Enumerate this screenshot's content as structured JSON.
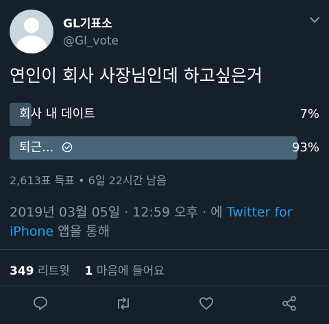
{
  "profile": {
    "display_name": "GL기표소",
    "handle": "@Gl_vote"
  },
  "tweet": {
    "text": "연인이 회사 사장님인데 하고싶은거"
  },
  "poll": {
    "options": [
      {
        "label": "회사 내 데이트",
        "percent_text": "7%",
        "fraction": 0.07,
        "winner": false
      },
      {
        "label": "퇴근...",
        "percent_text": "93%",
        "fraction": 0.93,
        "winner": true
      }
    ],
    "meta": "2,613표 득표 • 6일 22시간 남음"
  },
  "timestamp": {
    "prefix": "2019년 03월 05일 · 12:59 오후 · 에 ",
    "source_link": "Twitter for iPhone",
    "suffix": " 앱을 통해"
  },
  "stats": {
    "retweets_count": "349",
    "retweets_label": "리트윗",
    "likes_count": "1",
    "likes_label": "마음에 들어요"
  },
  "colors": {
    "background": "#15202b",
    "secondary_text": "#8899a6",
    "link": "#1da1f2",
    "poll_bar": "#3d5466"
  },
  "icons": [
    "chevron-down-icon",
    "check-circle-icon",
    "reply-icon",
    "retweet-icon",
    "like-icon",
    "share-icon"
  ]
}
